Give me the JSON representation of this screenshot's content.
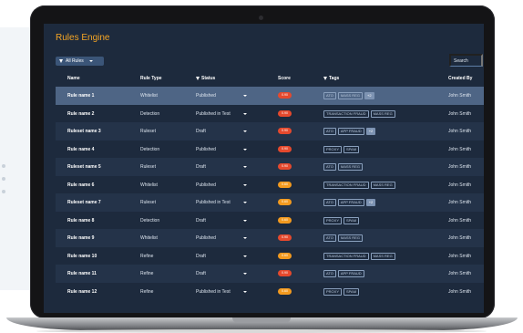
{
  "app": {
    "title": "Rules Engine"
  },
  "toolbar": {
    "filter_label": "All Rules",
    "search_placeholder": "Search"
  },
  "columns": {
    "name": "Name",
    "type": "Rule Type",
    "status": "Status",
    "score": "Score",
    "tags": "Tags",
    "created": "Created By"
  },
  "colors": {
    "accent": "#f5a524",
    "score_red": "#e5492d",
    "score_orange": "#f39a1f",
    "selected_row": "#4e6585"
  },
  "rows": [
    {
      "name": "Rule name 1",
      "type": "Whitelist",
      "status": "Published",
      "score": "0.90",
      "score_color": "red",
      "tags": [
        "ATO",
        "MASS REG",
        "+2"
      ],
      "created": "John Smith",
      "selected": true
    },
    {
      "name": "Rule name 2",
      "type": "Detection",
      "status": "Published in Test",
      "score": "0.90",
      "score_color": "red",
      "tags": [
        "TRANSACTION FRAUD",
        "MASS REG"
      ],
      "created": "John Smith",
      "selected": false
    },
    {
      "name": "Ruleset name 3",
      "type": "Ruleset",
      "status": "Draft",
      "score": "0.90",
      "score_color": "red",
      "tags": [
        "ATO",
        "APP FRAUD",
        "+2"
      ],
      "created": "John Smith",
      "selected": false
    },
    {
      "name": "Rule name 4",
      "type": "Detection",
      "status": "Published",
      "score": "0.90",
      "score_color": "red",
      "tags": [
        "PROXY",
        "SPAM"
      ],
      "created": "John Smith",
      "selected": false
    },
    {
      "name": "Ruleset name 5",
      "type": "Ruleset",
      "status": "Draft",
      "score": "0.90",
      "score_color": "red",
      "tags": [
        "ATO",
        "MASS REG"
      ],
      "created": "John Smith",
      "selected": false
    },
    {
      "name": "Rule name 6",
      "type": "Whitelist",
      "status": "Published",
      "score": "0.60",
      "score_color": "orange",
      "tags": [
        "TRANSACTION FRAUD",
        "MASS REG"
      ],
      "created": "John Smith",
      "selected": false
    },
    {
      "name": "Ruleset name 7",
      "type": "Ruleset",
      "status": "Published in Test",
      "score": "0.60",
      "score_color": "orange",
      "tags": [
        "ATO",
        "APP FRAUD",
        "+2"
      ],
      "created": "John Smith",
      "selected": false
    },
    {
      "name": "Rule name 8",
      "type": "Detection",
      "status": "Draft",
      "score": "0.60",
      "score_color": "orange",
      "tags": [
        "PROXY",
        "SPAM"
      ],
      "created": "John Smith",
      "selected": false
    },
    {
      "name": "Rule name 9",
      "type": "Whitelist",
      "status": "Published",
      "score": "0.90",
      "score_color": "red",
      "tags": [
        "ATO",
        "MASS REG"
      ],
      "created": "John Smith",
      "selected": false
    },
    {
      "name": "Rule name 10",
      "type": "Refine",
      "status": "Draft",
      "score": "0.60",
      "score_color": "orange",
      "tags": [
        "TRANSACTION FRAUD",
        "MASS REG"
      ],
      "created": "John Smith",
      "selected": false
    },
    {
      "name": "Rule name 11",
      "type": "Refine",
      "status": "Draft",
      "score": "0.90",
      "score_color": "red",
      "tags": [
        "ATO",
        "APP FRAUD"
      ],
      "created": "John Smith",
      "selected": false
    },
    {
      "name": "Rule name 12",
      "type": "Refine",
      "status": "Published in Test",
      "score": "0.60",
      "score_color": "orange",
      "tags": [
        "PROXY",
        "SPAM"
      ],
      "created": "John Smith",
      "selected": false
    }
  ]
}
